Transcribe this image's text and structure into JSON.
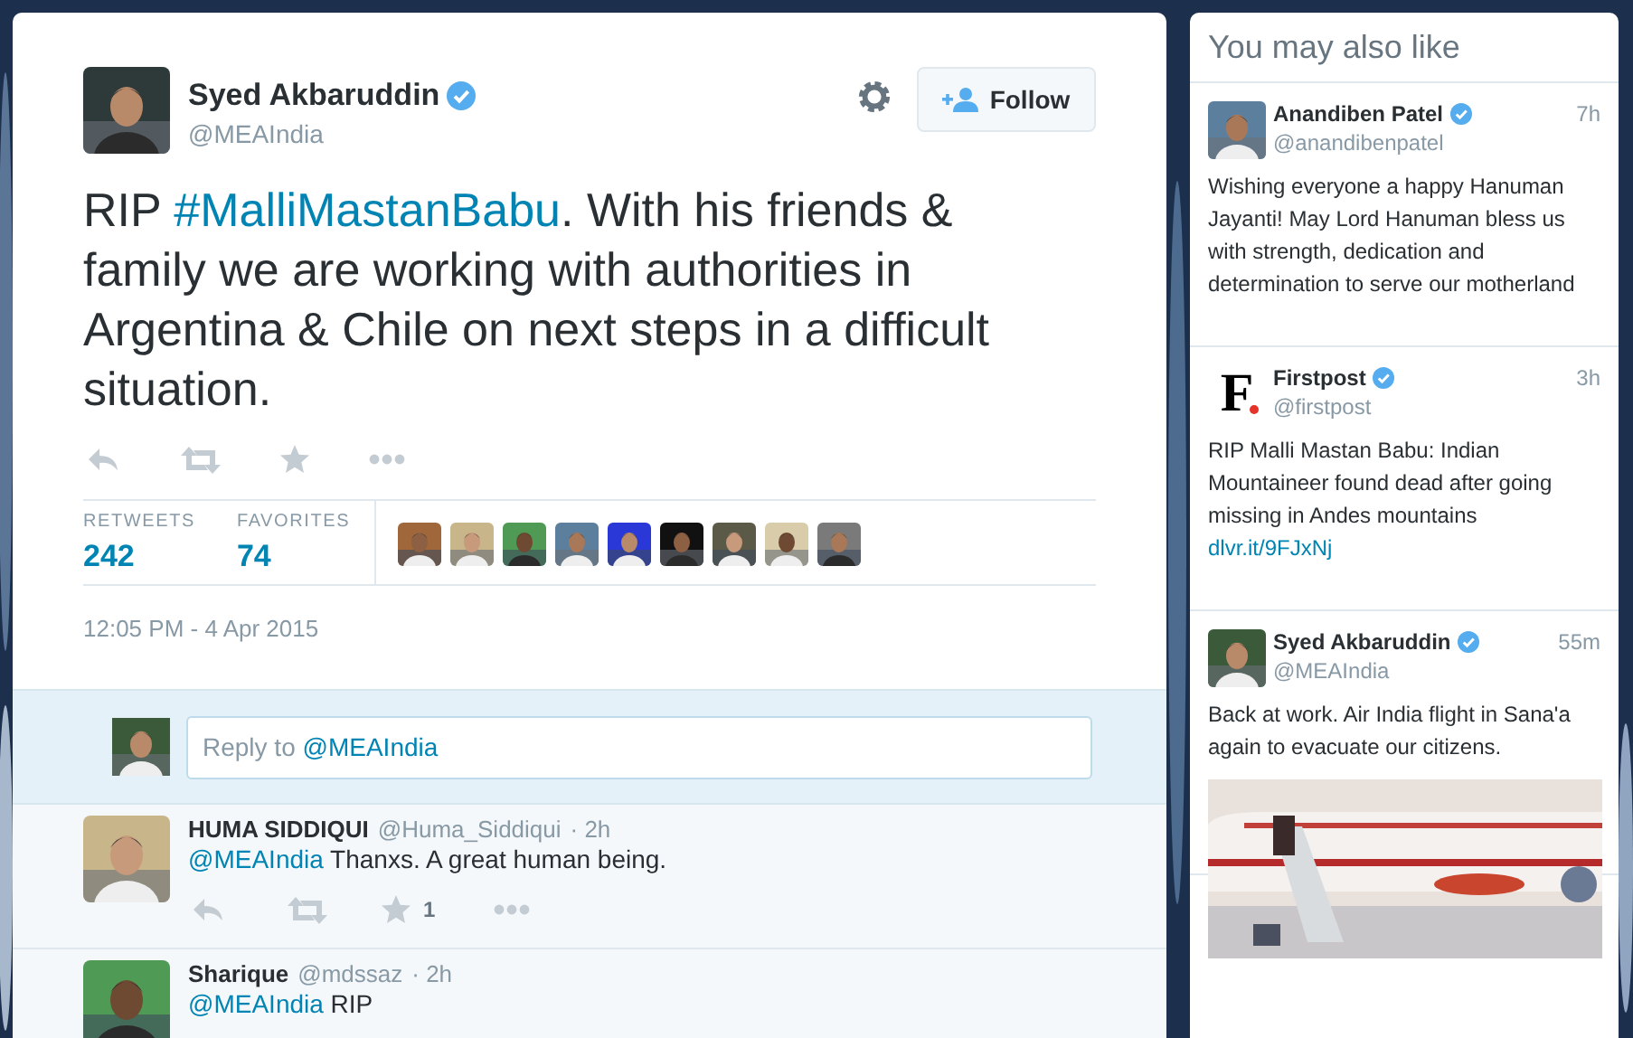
{
  "main_tweet": {
    "author": {
      "name": "Syed Akbaruddin",
      "verified": true,
      "handle": "@MEAIndia"
    },
    "follow_button": "Follow",
    "text": [
      {
        "kind": "plain",
        "text": "RIP "
      },
      {
        "kind": "link",
        "text": "#MalliMastanBabu"
      },
      {
        "kind": "plain",
        "text": ". With his friends & family we are working with authorities in Argentina & Chile on next steps in a difficult situation."
      }
    ],
    "stats": [
      {
        "label": "RETWEETS",
        "value": "242"
      },
      {
        "label": "FAVORITES",
        "value": "74"
      }
    ],
    "timestamp": "12:05 PM - 4 Apr 2015"
  },
  "reply_box": {
    "placeholder": "Reply to ",
    "mention": "@MEAIndia"
  },
  "replies": [
    {
      "name": "HUMA SIDDIQUI",
      "handle": "@Huma_Siddiqui",
      "time": "· 2h",
      "text": [
        {
          "kind": "link",
          "text": "@MEAIndia"
        },
        {
          "kind": "plain",
          "text": " Thanxs. A great human being."
        }
      ],
      "favorite_count": "1"
    },
    {
      "name": "Sharique",
      "handle": "@mdssaz",
      "time": "· 2h",
      "text": [
        {
          "kind": "link",
          "text": "@MEAIndia"
        },
        {
          "kind": "plain",
          "text": " RIP"
        }
      ]
    }
  ],
  "suggestions": {
    "title": "You may also like",
    "items": [
      {
        "name": "Anandiben Patel",
        "verified": true,
        "handle": "@anandibenpatel",
        "time": "7h",
        "text": "Wishing everyone a happy Hanuman Jayanti! May Lord Hanuman bless us with strength, dedication and determination to serve our motherland"
      },
      {
        "name": "Firstpost",
        "verified": true,
        "handle": "@firstpost",
        "time": "3h",
        "avatar": {
          "kind": "logo",
          "text": "F"
        },
        "text": "RIP Malli Mastan Babu: Indian Mountaineer found dead after going missing in Andes mountains",
        "link": "dlvr.it/9FJxNj"
      },
      {
        "name": "Syed Akbaruddin",
        "verified": true,
        "handle": "@MEAIndia",
        "time": "55m",
        "text": "Back at work. Air India flight in Sana'a again to evacuate our citizens."
      }
    ]
  }
}
